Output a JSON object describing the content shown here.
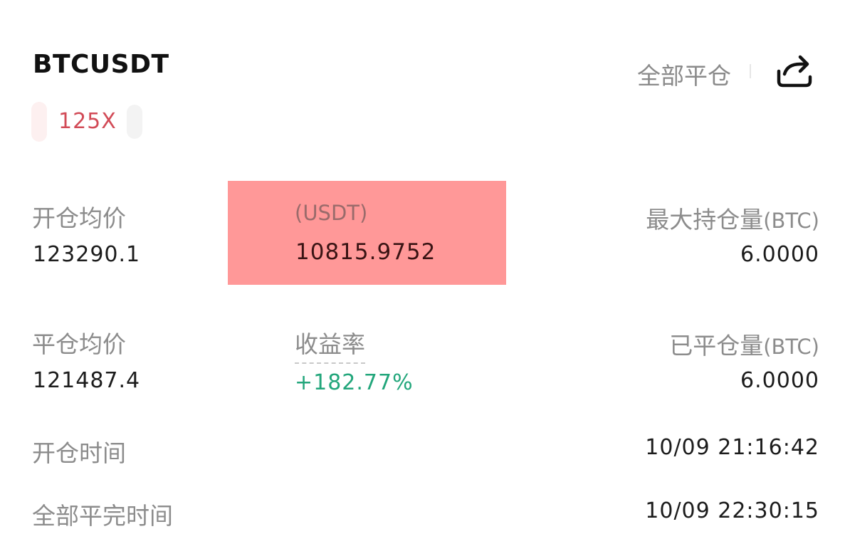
{
  "header": {
    "symbol": "BTCUSDT",
    "leverage": "125X",
    "close_all_label": "全部平仓",
    "share_icon": "share-icon"
  },
  "details": {
    "open_avg_price": {
      "label": "开仓均价",
      "value": "123290.1"
    },
    "pnl": {
      "unit": "(USDT)",
      "value": "10815.9752"
    },
    "max_position": {
      "label": "最大持仓量",
      "unit": "(BTC)",
      "value": "6.0000"
    },
    "close_avg_price": {
      "label": "平仓均价",
      "value": "121487.4"
    },
    "roe": {
      "label": "收益率",
      "value": "+182.77%"
    },
    "closed_qty": {
      "label": "已平仓量",
      "unit": "(BTC)",
      "value": "6.0000"
    },
    "open_time": {
      "label": "开仓时间",
      "value": "10/09 21:16:42"
    },
    "full_close_time": {
      "label": "全部平完时间",
      "value": "10/09 22:30:15"
    }
  },
  "colors": {
    "leverage_red": "#d24b57",
    "profit_green": "#22a67b",
    "redaction_block": "#ff9898",
    "label_gray": "#8c8c8c"
  }
}
